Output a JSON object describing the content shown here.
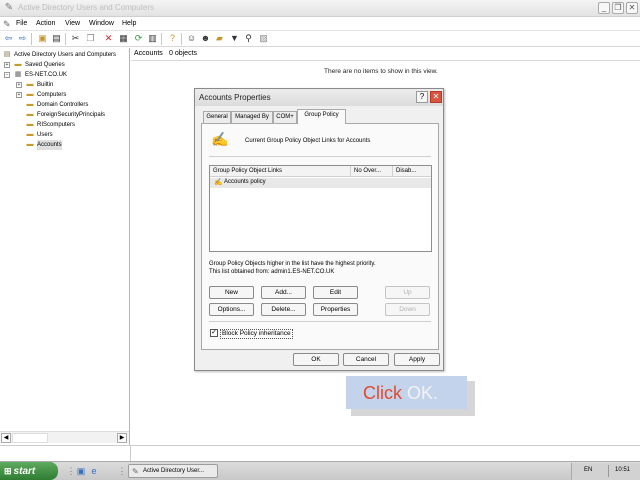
{
  "window": {
    "title": "Active Directory Users and Computers",
    "minimize": "_",
    "restore": "❐",
    "close": "✕"
  },
  "menus": [
    "File",
    "Action",
    "View",
    "Window",
    "Help"
  ],
  "toolbar_icons": [
    "back-icon",
    "forward-icon",
    "up-icon",
    "show-hide-tree-icon",
    "cut-icon",
    "copy-icon",
    "delete-icon",
    "properties-icon",
    "refresh-icon",
    "export-list-icon",
    "help-icon",
    "new-user-icon",
    "new-group-icon",
    "new-ou-icon",
    "filter-icon",
    "find-icon",
    "add-to-group-icon"
  ],
  "tree": {
    "root": "Active Directory Users and Computers",
    "items": [
      {
        "label": "Saved Queries",
        "level": 1,
        "expander": "+"
      },
      {
        "label": "ES-NET.CO.UK",
        "level": 1,
        "expander": "−"
      },
      {
        "label": "Builtin",
        "level": 2,
        "expander": "+"
      },
      {
        "label": "Computers",
        "level": 2,
        "expander": "+"
      },
      {
        "label": "Domain Controllers",
        "level": 2,
        "expander": ""
      },
      {
        "label": "ForeignSecurityPrincipals",
        "level": 2,
        "expander": ""
      },
      {
        "label": "RIScomputers",
        "level": 2,
        "expander": ""
      },
      {
        "label": "Users",
        "level": 2,
        "expander": ""
      },
      {
        "label": "Accounts",
        "level": 2,
        "expander": "",
        "selected": true
      }
    ]
  },
  "details": {
    "folder": "Accounts",
    "count": "0 objects",
    "empty_message": "There are no items to show in this view."
  },
  "dialog": {
    "title": "Accounts Properties",
    "help": "?",
    "close": "✕",
    "tabs": [
      "General",
      "Managed By",
      "COM+",
      "Group Policy"
    ],
    "active_tab": "Group Policy",
    "heading": "Current Group Policy Object Links for Accounts",
    "columns": [
      "Group Policy Object Links",
      "No Over...",
      "Disab..."
    ],
    "rows": [
      "Accounts policy"
    ],
    "note_line1": "Group Policy Objects higher in the list have the highest priority.",
    "note_line2": "This list obtained from: admin1.ES-NET.CO.UK",
    "buttons": {
      "new": "New",
      "add": "Add...",
      "edit": "Edit",
      "up": "Up",
      "options": "Options...",
      "delete": "Delete...",
      "properties": "Properties",
      "down": "Down"
    },
    "block_inheritance": "Block Policy inheritance",
    "block_checked": true,
    "ok": "OK",
    "cancel": "Cancel",
    "apply": "Apply"
  },
  "callout": {
    "prefix": "Click ",
    "highlight": "OK."
  },
  "taskbar": {
    "start": "start",
    "task": "Active Directory User...",
    "language": "EN",
    "clock": "10:51"
  }
}
